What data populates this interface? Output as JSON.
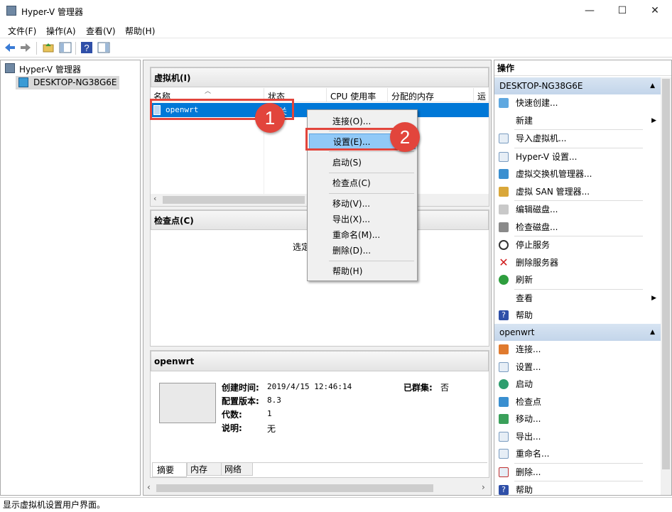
{
  "window": {
    "title": "Hyper-V 管理器",
    "minimize": "—",
    "maximize": "☐",
    "close": "✕"
  },
  "menu": [
    "文件(F)",
    "操作(A)",
    "查看(V)",
    "帮助(H)"
  ],
  "tree": {
    "root": "Hyper-V 管理器",
    "host": "DESKTOP-NG38G6E"
  },
  "vm_panel": {
    "title": "虚拟机(I)",
    "columns": [
      "名称",
      "状态",
      "CPU 使用率",
      "分配的内存",
      "运行"
    ],
    "rows": [
      {
        "name": "openwrt",
        "state": "关"
      }
    ]
  },
  "checkpoint_panel": {
    "title": "检查点(C)",
    "message": "选定"
  },
  "details": {
    "title": "openwrt",
    "fields": [
      {
        "label": "创建时间:",
        "value": "2019/4/15 12:46:14"
      },
      {
        "label": "配置版本:",
        "value": "8.3"
      },
      {
        "label": "代数:",
        "value": "1"
      },
      {
        "label": "说明:",
        "value": "无"
      }
    ],
    "clustered_label": "已群集:",
    "clustered_value": "否",
    "tabs": [
      "摘要",
      "内存",
      "网络"
    ]
  },
  "context_menu": [
    "连接(O)...",
    "设置(E)...",
    "启动(S)",
    "检查点(C)",
    "移动(V)...",
    "导出(X)...",
    "重命名(M)...",
    "删除(D)...",
    "帮助(H)"
  ],
  "callouts": [
    "1",
    "2"
  ],
  "actions": {
    "header": "操作",
    "host_section": "DESKTOP-NG38G6E",
    "host_items": [
      "快速创建...",
      "新建",
      "导入虚拟机...",
      "Hyper-V 设置...",
      "虚拟交换机管理器...",
      "虚拟 SAN 管理器...",
      "编辑磁盘...",
      "检查磁盘...",
      "停止服务",
      "删除服务器",
      "刷新",
      "查看",
      "帮助"
    ],
    "vm_section": "openwrt",
    "vm_items": [
      "连接...",
      "设置...",
      "启动",
      "检查点",
      "移动...",
      "导出...",
      "重命名...",
      "删除...",
      "帮助"
    ]
  },
  "status": "显示虚拟机设置用户界面。",
  "colors": {
    "selection": "#0078d7",
    "callout": "#e2453c",
    "section": "#c9daee"
  }
}
